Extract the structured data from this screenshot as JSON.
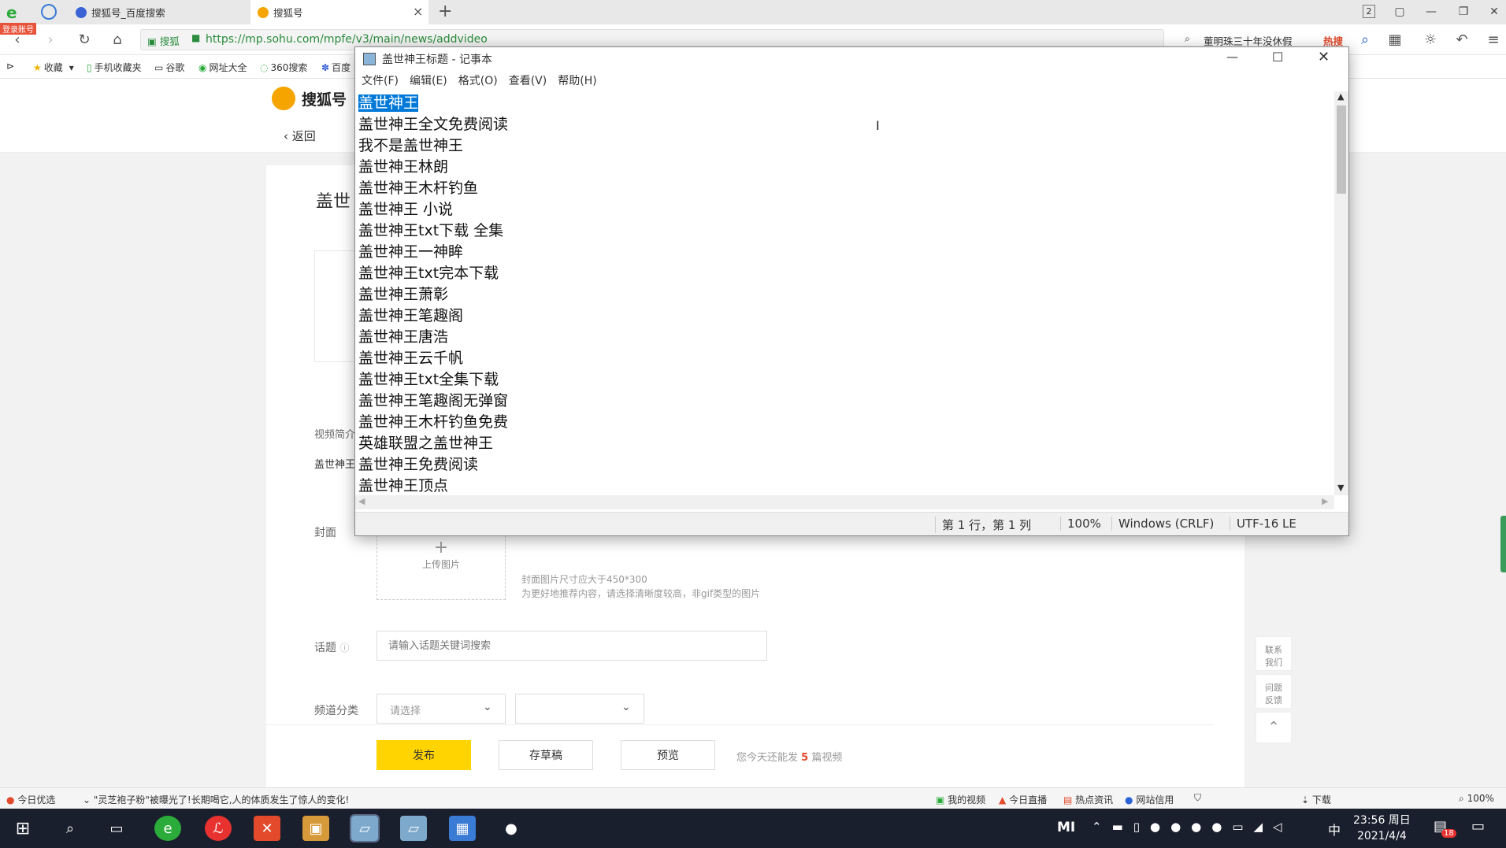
{
  "browser": {
    "badge": "登录账号",
    "tabs": [
      {
        "label": "搜狐号_百度搜索",
        "active": false
      },
      {
        "label": "搜狐号",
        "active": true
      }
    ],
    "window_badge": "2",
    "url_prefix": "搜狐",
    "url": "https://mp.sohu.com/mpfe/v3/main/news/addvideo",
    "search_text": "董明珠三十年没休假",
    "hot_label": "热搜",
    "bookmarks": [
      "收藏",
      "手机收藏夹",
      "谷歌",
      "网址大全",
      "360搜索",
      "百度"
    ],
    "status_left": "今日优选",
    "status_news": "\"灵芝袍子粉\"被曝光了!长期喝它,人的体质发生了惊人的变化!",
    "status_right": [
      "我的视频",
      "今日直播",
      "热点资讯",
      "网站信用",
      "下载",
      "100%"
    ]
  },
  "sohu": {
    "logo": "搜狐号",
    "back": "返回",
    "title_partial": "盖世",
    "intro_label": "视频简介",
    "intro_value": "盖世神王",
    "cover_label": "封面",
    "upload_plus": "+",
    "upload_label": "上传图片",
    "cover_hint1": "封面图片尺寸应大于450*300",
    "cover_hint2": "为更好地推荐内容，请选择清晰度较高，非gif类型的图片",
    "topic_label": "话题",
    "topic_placeholder": "请输入话题关键词搜索",
    "channel_label": "频道分类",
    "channel_placeholder": "请选择",
    "publish": "发布",
    "save_draft": "存草稿",
    "preview": "预览",
    "remaining_prefix": "您今天还能发",
    "remaining_count": "5",
    "remaining_suffix": "篇视频",
    "side_contact": "联系我们",
    "side_feedback": "问题反馈"
  },
  "notepad": {
    "title": "盖世神王标题 - 记事本",
    "menu": [
      "文件(F)",
      "编辑(E)",
      "格式(O)",
      "查看(V)",
      "帮助(H)"
    ],
    "lines": [
      "盖世神王",
      "盖世神王全文免费阅读",
      "我不是盖世神王",
      "盖世神王林朗",
      "盖世神王木杆钓鱼",
      "盖世神王 小说",
      "盖世神王txt下载 全集",
      "盖世神王一神眸",
      "盖世神王txt完本下载",
      "盖世神王萧彰",
      "盖世神王笔趣阁",
      "盖世神王唐浩",
      "盖世神王云千帆",
      "盖世神王txt全集下载",
      "盖世神王笔趣阁无弹窗",
      "盖世神王木杆钓鱼免费",
      "英雄联盟之盖世神王",
      "盖世神王免费阅读",
      "盖世神王顶点"
    ],
    "status_pos": "第 1 行，第 1 列",
    "status_zoom": "100%",
    "status_eol": "Windows (CRLF)",
    "status_enc": "UTF-16 LE"
  },
  "taskbar": {
    "time": "23:56 周日",
    "date": "2021/4/4",
    "ime": "中",
    "notif_count": "18",
    "tray_brand": "MI"
  }
}
